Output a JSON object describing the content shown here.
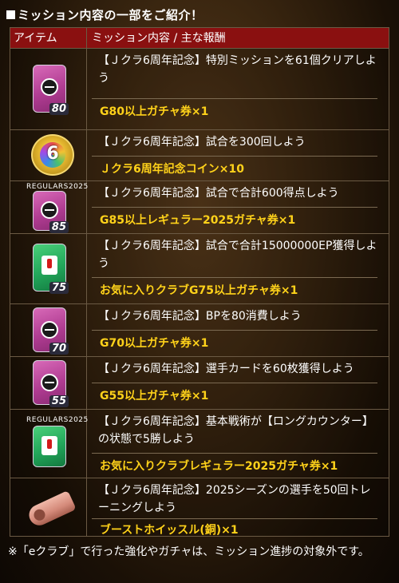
{
  "heading": "ミッション内容の一部をご紹介！",
  "table": {
    "col_item": "アイテム",
    "col_mission": "ミッション内容 / 主な報酬",
    "rows": [
      {
        "desc": "【Ｊクラ6周年記念】特別ミッションを61個クリアしよう",
        "reward": "G80以上ガチャ券×1",
        "icon": "pink-ticket-icon",
        "grade": "80"
      },
      {
        "desc": "【Ｊクラ6周年記念】試合を300回しよう",
        "reward": "Ｊクラ6周年記念コイン×10",
        "icon": "anniversary-coin-icon"
      },
      {
        "desc": "【Ｊクラ6周年記念】試合で合計600得点しよう",
        "reward": "G85以上レギュラー2025ガチャ券×1",
        "icon": "pink-ticket-icon",
        "grade": "85",
        "label": "REGULARS2025"
      },
      {
        "desc": "【Ｊクラ6周年記念】試合で合計15000000EP獲得しよう",
        "reward": "お気に入りクラブG75以上ガチャ券×1",
        "icon": "green-ticket-icon",
        "grade": "75"
      },
      {
        "desc": "【Ｊクラ6周年記念】BPを80消費しよう",
        "reward": "G70以上ガチャ券×1",
        "icon": "pink-ticket-icon",
        "grade": "70"
      },
      {
        "desc": "【Ｊクラ6周年記念】選手カードを60枚獲得しよう",
        "reward": "G55以上ガチャ券×1",
        "icon": "pink-ticket-icon",
        "grade": "55"
      },
      {
        "desc": "【Ｊクラ6周年記念】基本戦術が【ロングカウンター】の状態で5勝しよう",
        "reward": "お気に入りクラブレギュラー2025ガチャ券×1",
        "icon": "green-ticket-icon",
        "label": "REGULARS2025"
      },
      {
        "desc": "【Ｊクラ6周年記念】2025シーズンの選手を50回トレーニングしよう",
        "reward": "ブーストホイッスル(銅)×1",
        "icon": "whistle-icon"
      }
    ]
  },
  "footnote": "※「eクラブ」で行った強化やガチャは、ミッション進捗の対象外です。"
}
